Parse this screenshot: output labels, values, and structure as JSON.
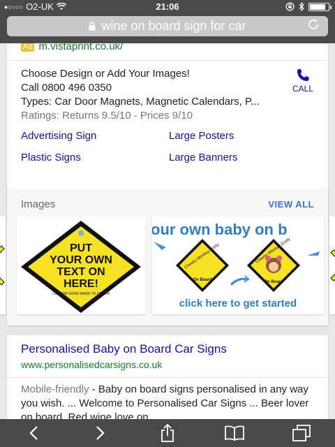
{
  "status_bar": {
    "signal_dots": "●○○○○",
    "carrier": "O2-UK",
    "time": "21:06"
  },
  "url_bar": {
    "query": "wine on board sign for car"
  },
  "ad": {
    "badge": "Ad",
    "display_url": "m.vistaprint.co.uk/",
    "lines": [
      "Choose Design or Add Your Images!",
      "Call 0800 496 0350",
      "Types: Car Door Magnets, Magnetic Calendars, P...",
      "Ratings: Returns 9.5/10 - Prices 9/10"
    ],
    "call_label": "CALL",
    "sitelinks": [
      "Advertising Sign",
      "Large Posters",
      "Plastic Signs",
      "Large Banners"
    ]
  },
  "images": {
    "heading": "Images",
    "view_all": "VIEW ALL",
    "thumb1_text": [
      "PUT",
      "YOUR OWN",
      "TEXT ON",
      "HERE!"
    ],
    "thumb1_small": "CUSTOM SIGNS MADE TO ORDER",
    "thumb2_banner": "our own baby on b",
    "thumb2_sign_top": "Cheeky Monkey Emily",
    "thumb2_sign_bottom": "On Board",
    "thumb2_footer": "click here to get started"
  },
  "result": {
    "title": "Personalised Baby on Board Car Signs",
    "url": "www.personalisedcarsigns.co.uk",
    "badge": "Mobile-friendly",
    "snippet": " - Baby on board signs personalised in any way you wish. ... Welcome to Personalised Car Signs ... Beer lover on board. Red wine love on"
  },
  "colors": {
    "link": "#1a0dab",
    "url_green": "#1b7a2a",
    "chrome": "#4a4a4a",
    "sign_yellow": "#f7e324"
  },
  "battery_level": 0.85
}
